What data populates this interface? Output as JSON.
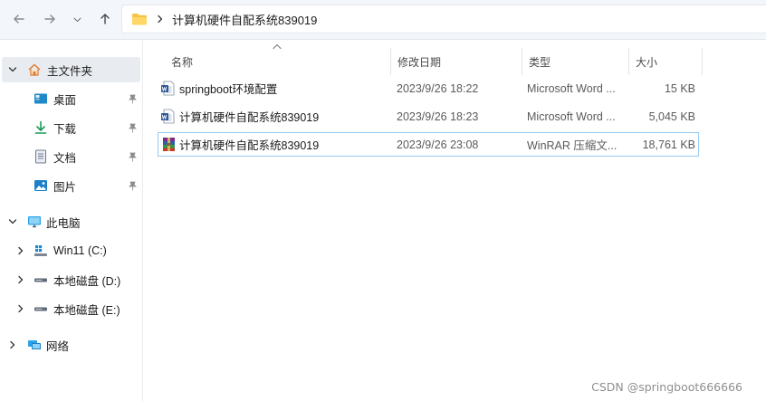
{
  "toolbar": {
    "back_icon": "arrow-left-icon",
    "forward_icon": "arrow-right-icon",
    "recent_icon": "chevron-down-icon",
    "up_icon": "arrow-up-icon"
  },
  "address": {
    "folder_icon": "folder-icon",
    "crumb": "计算机硬件自配系统839019"
  },
  "sidebar": {
    "items": [
      {
        "label": "主文件夹",
        "icon": "home-icon",
        "expanded": true
      },
      {
        "label": "桌面",
        "icon": "desktop-icon",
        "pinned": true
      },
      {
        "label": "下载",
        "icon": "download-icon",
        "pinned": true
      },
      {
        "label": "文档",
        "icon": "document-icon",
        "pinned": true
      },
      {
        "label": "图片",
        "icon": "pictures-icon",
        "pinned": true
      },
      {
        "label": "此电脑",
        "icon": "computer-icon",
        "expanded": true
      },
      {
        "label": "Win11 (C:)",
        "icon": "windows-drive-icon"
      },
      {
        "label": "本地磁盘 (D:)",
        "icon": "drive-icon"
      },
      {
        "label": "本地磁盘 (E:)",
        "icon": "drive-icon"
      },
      {
        "label": "网络",
        "icon": "network-icon"
      }
    ]
  },
  "columns": {
    "name": "名称",
    "date": "修改日期",
    "type": "类型",
    "size": "大小"
  },
  "files": [
    {
      "name": "springboot环境配置",
      "date": "2023/9/26 18:22",
      "type": "Microsoft Word ...",
      "size": "15 KB",
      "icon": "word-document-icon"
    },
    {
      "name": "计算机硬件自配系统839019",
      "date": "2023/9/26 18:23",
      "type": "Microsoft Word ...",
      "size": "5,045 KB",
      "icon": "word-document-icon"
    },
    {
      "name": "计算机硬件自配系统839019",
      "date": "2023/9/26 23:08",
      "type": "WinRAR 压缩文...",
      "size": "18,761 KB",
      "icon": "winrar-archive-icon"
    }
  ],
  "watermark": "CSDN @springboot666666",
  "colors": {
    "toolbar_bg": "#f3f6fb",
    "selection_border": "#99c9ef",
    "folder_yellow": "#f5c542",
    "word_blue": "#2b5797"
  }
}
